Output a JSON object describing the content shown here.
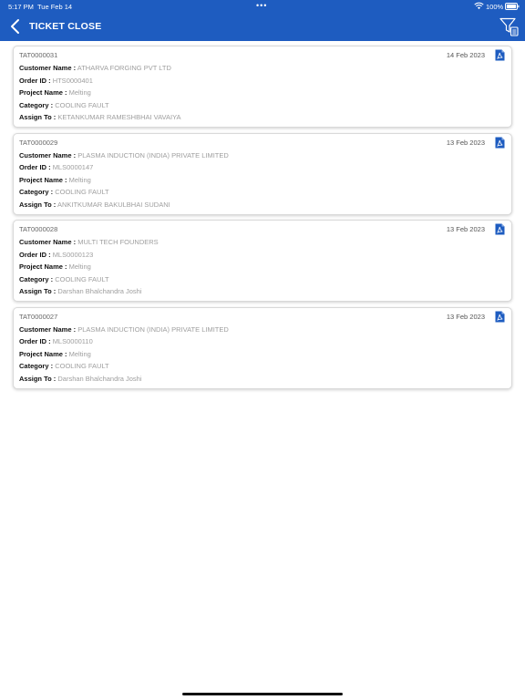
{
  "status_bar": {
    "time": "5:17 PM",
    "date": "Tue Feb 14",
    "dots": "•••",
    "battery": "100%"
  },
  "nav": {
    "title": "TICKET CLOSE"
  },
  "labels": {
    "customer": "Customer Name :",
    "order": "Order ID :",
    "project": "Project Name :",
    "category": "Category :",
    "assign": "Assign To :"
  },
  "tickets": [
    {
      "id": "TAT0000031",
      "date": "14 Feb 2023",
      "customer": "ATHARVA FORGING PVT LTD",
      "order_id": "HTS0000401",
      "project": "Melting",
      "category": "COOLING FAULT",
      "assign_to": "KETANKUMAR RAMESHBHAI VAVAIYA"
    },
    {
      "id": "TAT0000029",
      "date": "13 Feb 2023",
      "customer": "PLASMA INDUCTION (INDIA) PRIVATE LIMITED",
      "order_id": "MLS0000147",
      "project": "Melting",
      "category": "COOLING FAULT",
      "assign_to": "ANKITKUMAR BAKULBHAI SUDANI"
    },
    {
      "id": "TAT0000028",
      "date": "13 Feb 2023",
      "customer": "MULTI TECH FOUNDERS",
      "order_id": "MLS0000123",
      "project": "Melting",
      "category": "COOLING FAULT",
      "assign_to": "Darshan Bhalchandra Joshi"
    },
    {
      "id": "TAT0000027",
      "date": "13 Feb 2023",
      "customer": "PLASMA INDUCTION (INDIA) PRIVATE LIMITED",
      "order_id": "MLS0000110",
      "project": "Melting",
      "category": "COOLING FAULT",
      "assign_to": "Darshan Bhalchandra Joshi"
    }
  ],
  "icons": {
    "back": "chevron-left-icon",
    "filter": "filter-icon",
    "pdf": "pdf-icon",
    "wifi": "wifi-icon",
    "battery": "battery-icon"
  },
  "colors": {
    "header_bg": "#1e5cc0",
    "label": "#111111",
    "value": "#9e9e9e",
    "pdf_icon": "#1e5cc0"
  }
}
